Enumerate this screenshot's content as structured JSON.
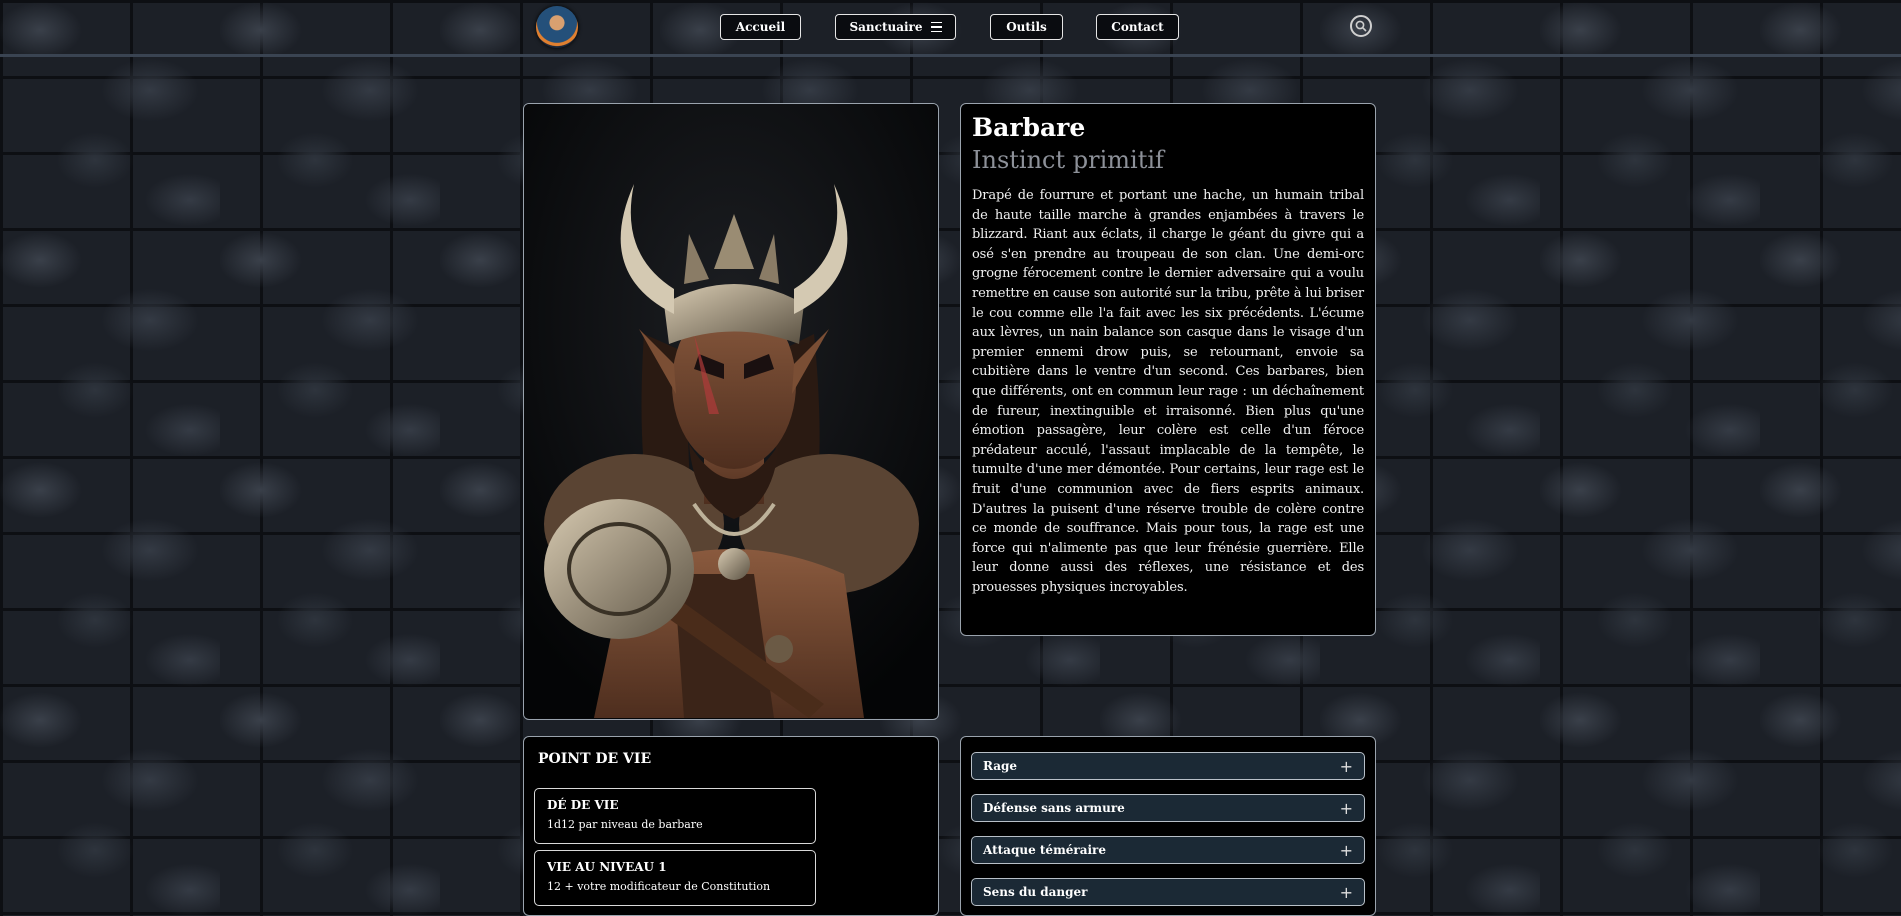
{
  "nav": {
    "home": "Accueil",
    "sanctuary": "Sanctuaire",
    "tools": "Outils",
    "contact": "Contact"
  },
  "class": {
    "name": "Barbare",
    "subtitle": "Instinct primitif",
    "description": "Drapé de fourrure et portant une hache, un humain tribal de haute taille marche à grandes enjambées à travers le blizzard. Riant aux éclats, il charge le géant du givre qui a osé s'en prendre au troupeau de son clan. Une demi-orc grogne férocement contre le dernier adversaire qui a voulu remettre en cause son autorité sur la tribu, prête à lui briser le cou comme elle l'a fait avec les six précédents. L'écume aux lèvres, un nain balance son casque dans le visage d'un premier ennemi drow puis, se retournant, envoie sa cubitière dans le ventre d'un second. Ces barbares, bien que différents, ont en commun leur rage : un déchaînement de fureur, inextinguible et irraisonné. Bien plus qu'une émotion passagère, leur colère est celle d'un féroce prédateur acculé, l'assaut implacable de la tempête, le tumulte d'une mer démontée. Pour certains, leur rage est le fruit d'une communion avec de fiers esprits animaux. D'autres la puisent d'une réserve trouble de colère contre ce monde de souffrance. Mais pour tous, la rage est une force qui n'alimente pas que leur frénésie guerrière. Elle leur donne aussi des réflexes, une résistance et des prouesses physiques incroyables."
  },
  "hit_points": {
    "title": "POINT DE VIE",
    "boxes": [
      {
        "title": "DÉ DE VIE",
        "value": "1d12 par niveau de barbare"
      },
      {
        "title": "VIE AU NIVEAU 1",
        "value": "12 + votre modificateur de Constitution"
      }
    ]
  },
  "features": [
    {
      "label": "Rage",
      "icon": "plus-icon"
    },
    {
      "label": "Défense sans armure",
      "icon": "plus-icon"
    },
    {
      "label": "Attaque téméraire",
      "icon": "plus-icon"
    },
    {
      "label": "Sens du danger",
      "icon": "plus-icon"
    }
  ],
  "colors": {
    "card_bg": "#000000",
    "feature_bg": "#1b2935",
    "subtitle": "#8d9199",
    "border": "#9aa3ad"
  }
}
